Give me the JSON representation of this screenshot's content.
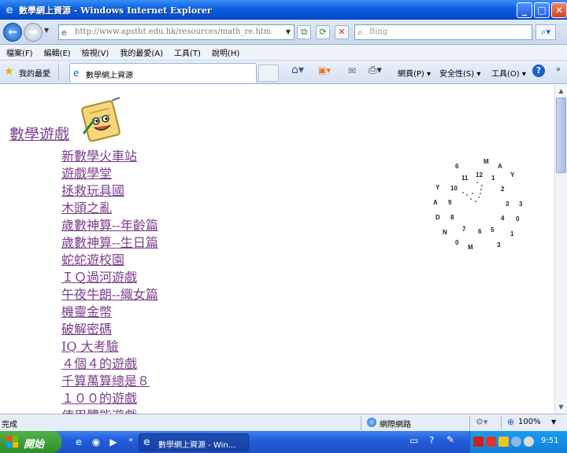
{
  "window": {
    "title": "數學網上資源 - Windows Internet Explorer"
  },
  "address": {
    "url": "http://www.apstht.edu.hk/resources/math_re.htm"
  },
  "search": {
    "placeholder": "Bing"
  },
  "menu": [
    "檔案(F)",
    "編輯(E)",
    "檢視(V)",
    "我的最愛(A)",
    "工具(T)",
    "說明(H)"
  ],
  "favorites": {
    "label": "我的最愛"
  },
  "tab": {
    "label": "數學網上資源"
  },
  "commands": {
    "page": "網頁(P) ▾",
    "safety": "安全性(S) ▾",
    "tools": "工具(O) ▾",
    "more": "»"
  },
  "content": {
    "heading": "數學遊戲",
    "games": [
      "新數學火車站",
      "遊戲學堂",
      "拯救玩具國",
      "木頭之亂",
      "歲數神算--年齡篇",
      "歲數神算--生日篇",
      "蛇蛇遊校園",
      "ＩＱ過河遊戲",
      "午夜牛朗--織女篇",
      "機靈金幣",
      "破解密碼",
      "IQ 大考驗",
      "４個４的遊戲",
      "千算萬算總是８",
      "１００的遊戲",
      "使用體能遊戲"
    ]
  },
  "puzzle_marks": [
    "6",
    "M",
    "A",
    "11",
    "12",
    "1",
    "Y",
    "Y",
    "10",
    "2",
    "A",
    "9",
    "3",
    "3",
    "D",
    "8",
    "4",
    "0",
    "N",
    "7",
    "6",
    "5",
    "1",
    "0",
    "M",
    "3"
  ],
  "status": {
    "text": "完成",
    "zone": "網際網路",
    "zoom": "100%"
  },
  "taskbar": {
    "start": "開始",
    "task_label": "數學網上資源 - Win...",
    "clock": "9:51"
  },
  "icons": [
    "ie-logo-icon",
    "back-arrow-icon",
    "forward-arrow-icon",
    "page-icon",
    "refresh-icon",
    "stop-icon",
    "search-icon",
    "star-icon",
    "home-icon",
    "feeds-icon",
    "mail-icon",
    "print-icon",
    "help-icon",
    "globe-icon",
    "zoom-icon",
    "windows-logo-icon"
  ]
}
